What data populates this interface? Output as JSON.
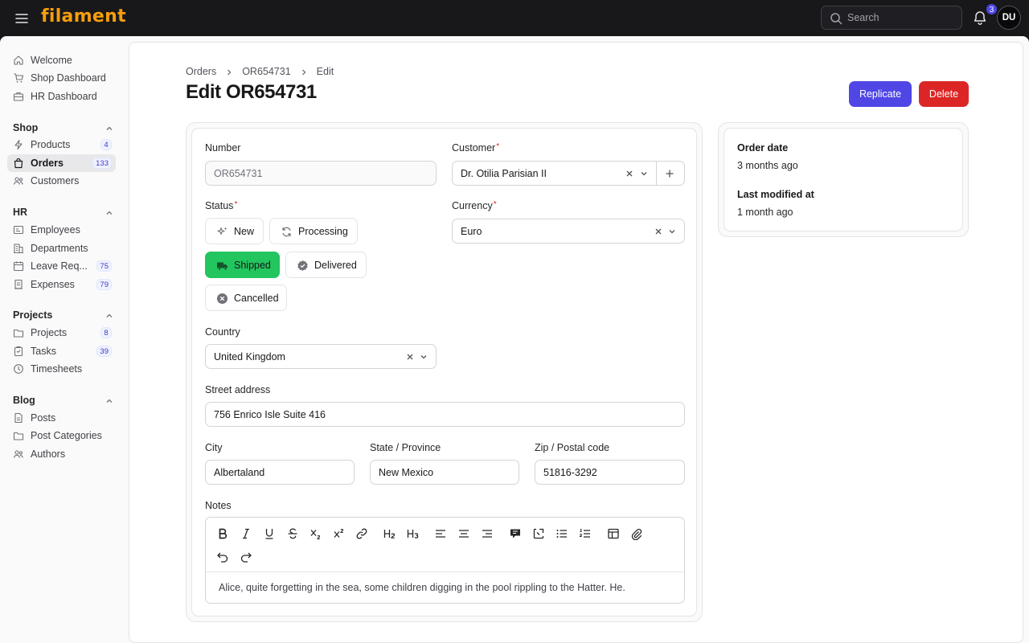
{
  "app": {
    "logo": "filament",
    "search_placeholder": "Search",
    "notifications_count": "3",
    "user_initials": "DU"
  },
  "sidebar": {
    "top": [
      {
        "label": "Welcome"
      },
      {
        "label": "Shop Dashboard"
      },
      {
        "label": "HR Dashboard"
      }
    ],
    "groups": [
      {
        "title": "Shop",
        "items": [
          {
            "label": "Products",
            "badge": "4"
          },
          {
            "label": "Orders",
            "badge": "133",
            "active": true
          },
          {
            "label": "Customers"
          }
        ]
      },
      {
        "title": "HR",
        "items": [
          {
            "label": "Employees"
          },
          {
            "label": "Departments"
          },
          {
            "label": "Leave Req...",
            "badge": "75"
          },
          {
            "label": "Expenses",
            "badge": "79"
          }
        ]
      },
      {
        "title": "Projects",
        "items": [
          {
            "label": "Projects",
            "badge": "8"
          },
          {
            "label": "Tasks",
            "badge": "39"
          },
          {
            "label": "Timesheets"
          }
        ]
      },
      {
        "title": "Blog",
        "items": [
          {
            "label": "Posts"
          },
          {
            "label": "Post Categories"
          },
          {
            "label": "Authors"
          }
        ]
      }
    ]
  },
  "breadcrumb": [
    "Orders",
    "OR654731",
    "Edit"
  ],
  "page": {
    "title": "Edit OR654731",
    "replicate_label": "Replicate",
    "delete_label": "Delete"
  },
  "form": {
    "number_label": "Number",
    "number_value": "OR654731",
    "customer_label": "Customer",
    "customer_value": "Dr. Otilia Parisian II",
    "status_label": "Status",
    "statuses": [
      {
        "label": "New",
        "icon": "sparkles-icon"
      },
      {
        "label": "Processing",
        "icon": "arrows-rotate-icon"
      },
      {
        "label": "Shipped",
        "icon": "truck-icon",
        "selected": true
      },
      {
        "label": "Delivered",
        "icon": "check-badge-icon"
      },
      {
        "label": "Cancelled",
        "icon": "x-circle-icon"
      }
    ],
    "currency_label": "Currency",
    "currency_value": "Euro",
    "country_label": "Country",
    "country_value": "United Kingdom",
    "street_label": "Street address",
    "street_value": "756 Enrico Isle Suite 416",
    "city_label": "City",
    "city_value": "Albertaland",
    "state_label": "State / Province",
    "state_value": "New Mexico",
    "zip_label": "Zip / Postal code",
    "zip_value": "51816-3292",
    "notes_label": "Notes",
    "notes_value": "Alice, quite forgetting in the sea, some children digging in the pool rippling to the Hatter. He."
  },
  "meta": {
    "order_date_label": "Order date",
    "order_date_value": "3 months ago",
    "modified_label": "Last modified at",
    "modified_value": "1 month ago"
  },
  "colors": {
    "accent": "#4f46e5",
    "danger": "#dc2626",
    "success": "#22c55e",
    "brand": "#f59e0b"
  }
}
